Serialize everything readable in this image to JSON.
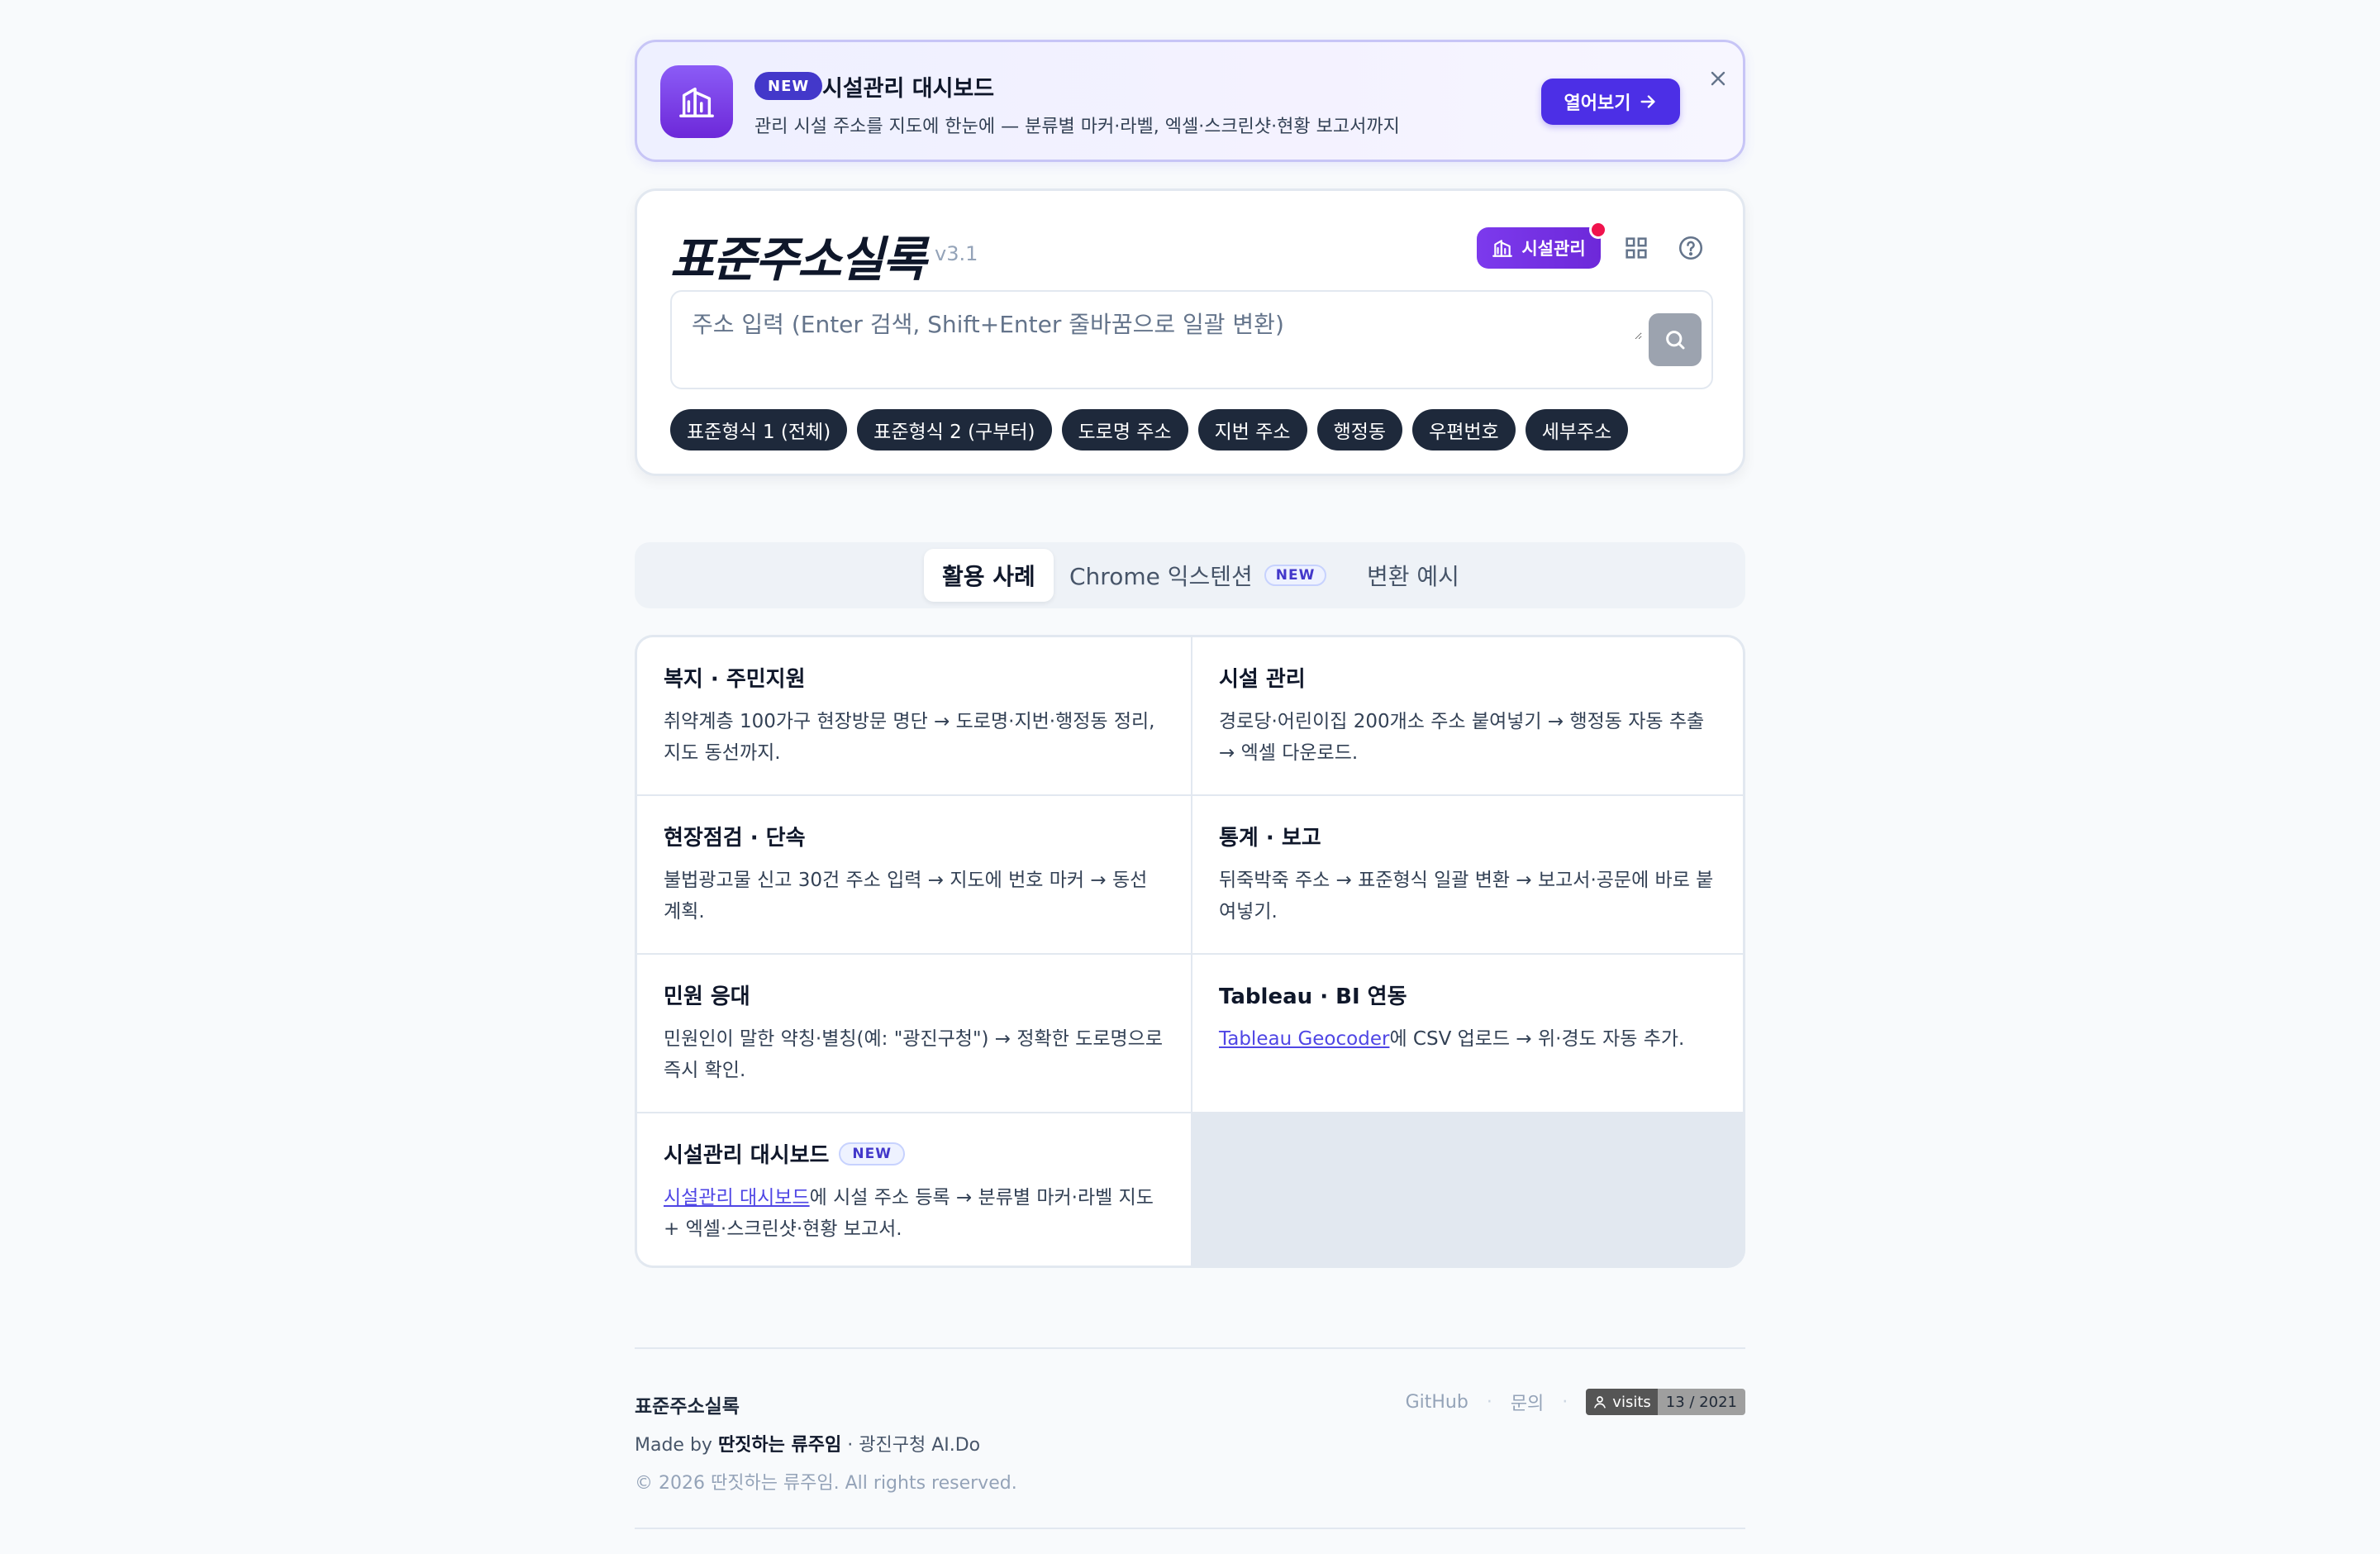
{
  "banner": {
    "badge": "NEW",
    "title": "시설관리 대시보드",
    "description": "관리 시설 주소를 지도에 한눈에 — 분류별 마커·라벨, 엑셀·스크린샷·현황 보고서까지",
    "button_label": "열어보기",
    "icon": "building-icon"
  },
  "header": {
    "logo": "표준주소실록",
    "version": "v3.1",
    "facility_button": "시설관리"
  },
  "search": {
    "placeholder": "주소 입력 (Enter 검색, Shift+Enter 줄바꿈으로 일괄 변환)"
  },
  "chips": [
    "표준형식 1 (전체)",
    "표준형식 2 (구부터)",
    "도로명 주소",
    "지번 주소",
    "행정동",
    "우편번호",
    "세부주소"
  ],
  "tabs": {
    "items": [
      {
        "label": "활용 사례",
        "active": true
      },
      {
        "label": "Chrome 익스텐션",
        "badge": "NEW"
      },
      {
        "label": "변환 예시"
      }
    ]
  },
  "cases": [
    {
      "title": "복지 · 주민지원",
      "desc": "취약계층 100가구 현장방문 명단 → 도로명·지번·행정동 정리, 지도 동선까지."
    },
    {
      "title": "시설 관리",
      "desc": "경로당·어린이집 200개소 주소 붙여넣기 → 행정동 자동 추출 → 엑셀 다운로드."
    },
    {
      "title": "현장점검 · 단속",
      "desc": "불법광고물 신고 30건 주소 입력 → 지도에 번호 마커 → 동선 계획."
    },
    {
      "title": "통계 · 보고",
      "desc": "뒤죽박죽 주소 → 표준형식 일괄 변환 → 보고서·공문에 바로 붙여넣기."
    },
    {
      "title": "민원 응대",
      "desc": "민원인이 말한 약칭·별칭(예: \"광진구청\") → 정확한 도로명으로 즉시 확인."
    },
    {
      "title": "Tableau · BI 연동",
      "link": "Tableau Geocoder",
      "desc": "에 CSV 업로드 → 위·경도 자동 추가."
    },
    {
      "title": "시설관리 대시보드",
      "badge": "NEW",
      "link": "시설관리 대시보드",
      "desc": "에 시설 주소 등록 → 분류별 마커·라벨 지도 + 엑셀·스크린샷·현황 보고서."
    }
  ],
  "footer": {
    "brand": "표준주소실록",
    "made_by_prefix": "Made by ",
    "made_by_name": "딴짓하는 류주임",
    "made_by_suffix": " · 광진구청 AI.Do",
    "copyright": "© 2026 딴짓하는 류주임. All rights reserved.",
    "links": [
      "GitHub",
      "문의"
    ],
    "separator": "·",
    "visits_label": "visits",
    "visits_value": "13 / 2021"
  },
  "colors": {
    "accent": "#4c2fe6",
    "chip": "#1e293b",
    "notification": "#f0134d"
  }
}
